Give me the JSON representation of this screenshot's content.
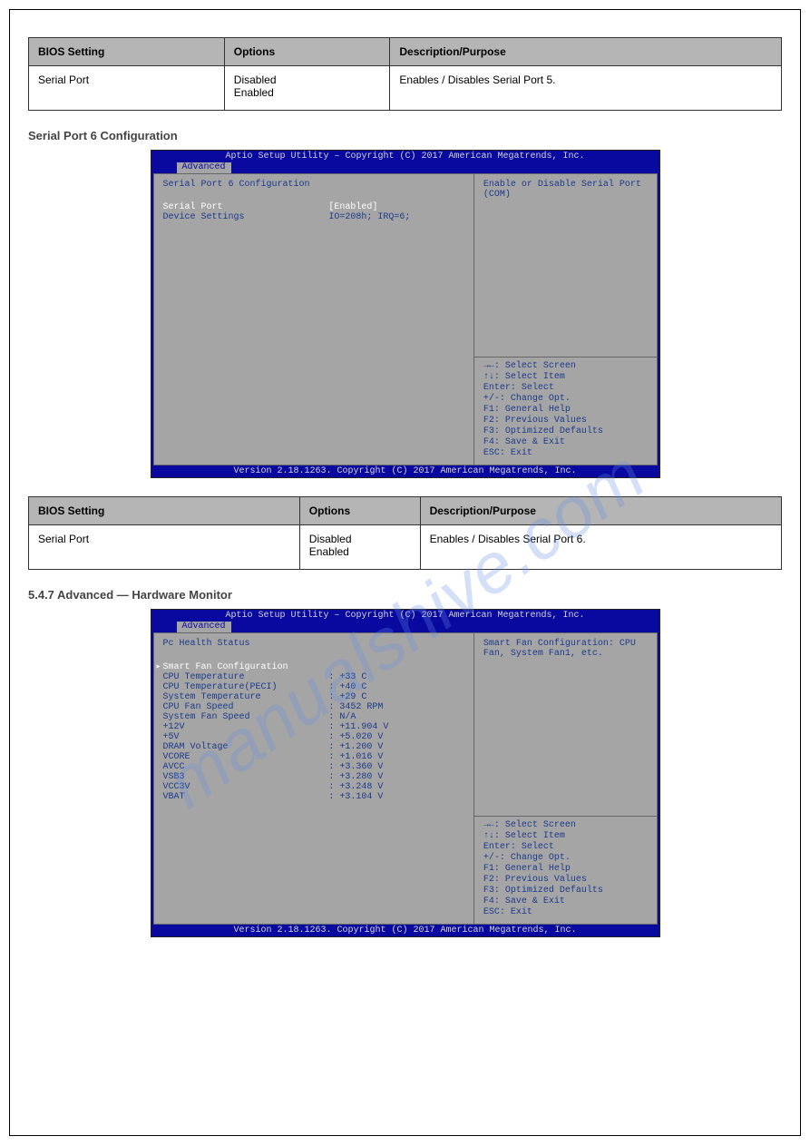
{
  "watermark": "manualshive.com",
  "table1": {
    "headers": [
      "BIOS Setting",
      "Options",
      "Description/Purpose"
    ],
    "rows": [
      [
        "Serial Port",
        "Disabled\nEnabled",
        "Enables / Disables Serial Port 5."
      ]
    ]
  },
  "heading1": "Serial Port 6 Configuration",
  "bios1": {
    "title": "Aptio Setup Utility – Copyright (C) 2017 American Megatrends, Inc.",
    "tab": "Advanced",
    "section": "Serial Port 6 Configuration",
    "selected_row": {
      "label": "Serial Port",
      "value": "[Enabled]"
    },
    "rows": [
      {
        "label": "Device Settings",
        "value": "IO=208h; IRQ=6;"
      }
    ],
    "help": "Enable or Disable Serial Port (COM)",
    "keys": [
      "→←: Select Screen",
      "↑↓: Select Item",
      "Enter: Select",
      "+/-: Change Opt.",
      "F1: General Help",
      "F2: Previous Values",
      "F3: Optimized Defaults",
      "F4: Save & Exit",
      "ESC: Exit"
    ],
    "footer": "Version 2.18.1263. Copyright (C) 2017 American Megatrends, Inc."
  },
  "table2": {
    "headers": [
      "BIOS Setting",
      "Options",
      "Description/Purpose"
    ],
    "rows": [
      [
        "Serial Port",
        "Disabled\nEnabled",
        "Enables / Disables Serial Port 6."
      ]
    ]
  },
  "heading2": "5.4.7 Advanced — Hardware Monitor",
  "bios2": {
    "title": "Aptio Setup Utility – Copyright (C) 2017 American Megatrends, Inc.",
    "tab": "Advanced",
    "section": "Pc Health Status",
    "submenu": "Smart Fan Configuration",
    "rows": [
      {
        "label": "CPU Temperature",
        "value": ": +33 C"
      },
      {
        "label": "CPU Temperature(PECI)",
        "value": ": +40 C"
      },
      {
        "label": "System Temperature",
        "value": ": +29 C"
      },
      {
        "label": "CPU Fan Speed",
        "value": ": 3452 RPM"
      },
      {
        "label": "System Fan Speed",
        "value": ": N/A"
      },
      {
        "label": "+12V",
        "value": ": +11.904 V"
      },
      {
        "label": "+5V",
        "value": ": +5.020 V"
      },
      {
        "label": "DRAM Voltage",
        "value": ": +1.200 V"
      },
      {
        "label": "VCORE",
        "value": ": +1.016 V"
      },
      {
        "label": "AVCC",
        "value": ": +3.360 V"
      },
      {
        "label": "VSB3",
        "value": ": +3.280 V"
      },
      {
        "label": "VCC3V",
        "value": ": +3.248 V"
      },
      {
        "label": "VBAT",
        "value": ": +3.104 V"
      }
    ],
    "help": "Smart Fan Configuration: CPU Fan, System Fan1, etc.",
    "keys": [
      "→←: Select Screen",
      "↑↓: Select Item",
      "Enter: Select",
      "+/-: Change Opt.",
      "F1: General Help",
      "F2: Previous Values",
      "F3: Optimized Defaults",
      "F4: Save & Exit",
      "ESC: Exit"
    ],
    "footer": "Version 2.18.1263. Copyright (C) 2017 American Megatrends, Inc."
  }
}
